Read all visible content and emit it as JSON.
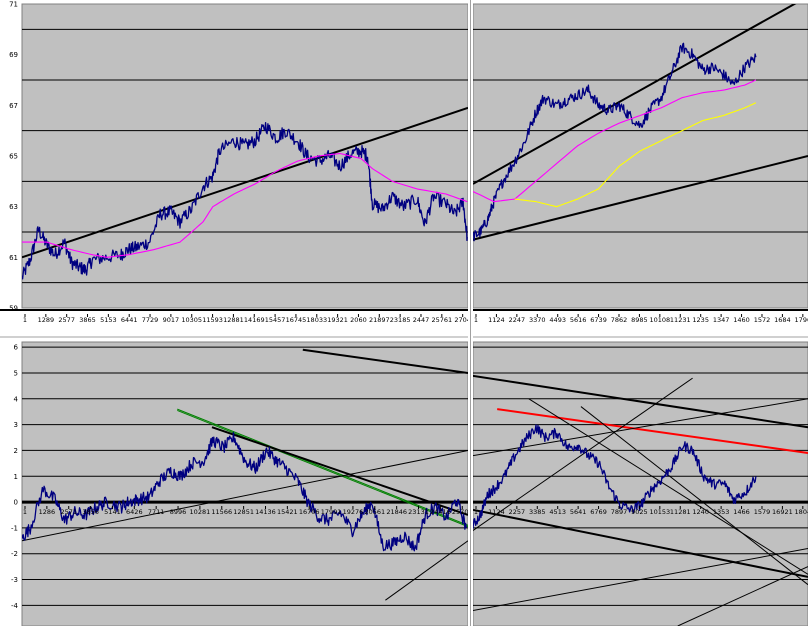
{
  "colors": {
    "plot_bg": "#c0c0c0",
    "frame": "#ffffff",
    "grid": "#000000",
    "price": "#000080",
    "ma_magenta": "#ff00ff",
    "ma_yellow": "#ffff00",
    "trend_black": "#000000",
    "trend_red": "#ff0000",
    "trend_green": "#008000"
  },
  "chart_data": [
    {
      "id": "top-left",
      "type": "line",
      "ylim": [
        59,
        71
      ],
      "y_ticks": [
        "71",
        "69",
        "67",
        "65",
        "63",
        "61",
        "59"
      ],
      "x_ticks": [
        "1",
        "1289",
        "2577",
        "3865",
        "5153",
        "6441",
        "7729",
        "9017",
        "10305",
        "11593",
        "12881",
        "14169",
        "15457",
        "16745",
        "18033",
        "19321",
        "2060",
        "21897",
        "23185",
        "2447",
        "25761",
        "2704"
      ],
      "xlim": [
        1,
        27100
      ],
      "series": [
        {
          "role": "price",
          "color": "#000080",
          "x": [
            1,
            500,
            1000,
            1500,
            2000,
            2577,
            3000,
            3500,
            3865,
            4300,
            5153,
            6000,
            6441,
            7000,
            7729,
            8400,
            9017,
            9600,
            10305,
            11000,
            11593,
            12000,
            12881,
            13500,
            14169,
            14800,
            15457,
            16000,
            16745,
            17300,
            18033,
            18700,
            19321,
            20000,
            20600,
            21000,
            21300,
            21897,
            22500,
            23185,
            24000,
            24470,
            25000,
            25761,
            26300,
            26800,
            27050
          ],
          "y": [
            60.2,
            60.9,
            62.1,
            61.5,
            61.1,
            61.6,
            60.8,
            60.6,
            60.5,
            60.9,
            61.0,
            61.1,
            61.3,
            61.4,
            61.6,
            62.7,
            62.8,
            62.4,
            62.9,
            63.8,
            64.2,
            65.2,
            65.6,
            65.4,
            65.6,
            66.2,
            65.7,
            66.0,
            65.6,
            65.0,
            64.8,
            65.0,
            64.6,
            65.1,
            65.2,
            65.0,
            63.1,
            62.9,
            63.4,
            63.0,
            63.3,
            62.3,
            63.4,
            63.1,
            62.7,
            63.2,
            61.8
          ],
          "noise": 0.26
        },
        {
          "role": "ma-magenta",
          "color": "#ff00ff",
          "x": [
            1,
            1500,
            3000,
            4300,
            5153,
            6441,
            8000,
            9600,
            10305,
            11000,
            11593,
            12881,
            14169,
            15457,
            16745,
            18033,
            19321,
            20600,
            21300,
            22500,
            24000,
            25761,
            27050
          ],
          "y": [
            61.6,
            61.6,
            61.3,
            61.1,
            61.0,
            61.1,
            61.3,
            61.6,
            62.0,
            62.4,
            63.0,
            63.5,
            63.9,
            64.4,
            64.8,
            65.0,
            65.1,
            64.9,
            64.5,
            64.0,
            63.7,
            63.5,
            63.2
          ],
          "noise": 0
        }
      ],
      "trendlines": [
        {
          "color": "#000000",
          "x1": 0,
          "y1": 61.0,
          "x2": 27100,
          "y2": 66.9,
          "width": 2
        }
      ]
    },
    {
      "id": "top-right",
      "type": "line",
      "ylim": [
        59,
        71
      ],
      "x_ticks": [
        "1",
        "1124",
        "2247",
        "3370",
        "4493",
        "5616",
        "6739",
        "7862",
        "8985",
        "10108",
        "11231",
        "1235",
        "1347",
        "1460",
        "1572",
        "1684",
        "1796"
      ],
      "xlim": [
        1,
        18000
      ],
      "series": [
        {
          "role": "price",
          "color": "#000080",
          "x": [
            1,
            400,
            800,
            1124,
            1600,
            2247,
            2800,
            3370,
            3800,
            4493,
            5000,
            5616,
            6200,
            6739,
            7300,
            7862,
            8400,
            8985,
            9500,
            10108,
            10700,
            11231,
            11800,
            12350,
            12900,
            13470,
            14000,
            14600,
            15200
          ],
          "y": [
            61.8,
            62.0,
            62.5,
            63.2,
            64.0,
            64.8,
            65.6,
            66.7,
            67.3,
            67.0,
            67.2,
            67.4,
            67.6,
            67.0,
            66.8,
            67.0,
            66.6,
            66.2,
            66.8,
            67.3,
            68.3,
            69.3,
            69.0,
            68.4,
            68.5,
            68.2,
            67.8,
            68.5,
            68.9
          ],
          "noise": 0.22
        },
        {
          "role": "ma-magenta",
          "color": "#ff00ff",
          "x": [
            1,
            1124,
            2247,
            3370,
            4493,
            5616,
            6739,
            7862,
            8985,
            10108,
            11231,
            12350,
            13470,
            14600,
            15200
          ],
          "y": [
            63.6,
            63.2,
            63.3,
            64.0,
            64.7,
            65.4,
            65.9,
            66.3,
            66.6,
            66.9,
            67.3,
            67.5,
            67.6,
            67.8,
            68.0
          ],
          "noise": 0
        },
        {
          "role": "ma-yellow",
          "color": "#ffff00",
          "x": [
            2247,
            3370,
            4493,
            5616,
            6739,
            7862,
            8985,
            10108,
            11231,
            12350,
            13470,
            14600,
            15200
          ],
          "y": [
            63.3,
            63.2,
            63.0,
            63.3,
            63.7,
            64.6,
            65.2,
            65.6,
            66.0,
            66.4,
            66.6,
            66.9,
            67.1
          ],
          "noise": 0
        }
      ],
      "trendlines": [
        {
          "color": "#000000",
          "x1": 1,
          "y1": 63.9,
          "x2": 18000,
          "y2": 71.3,
          "width": 2
        },
        {
          "color": "#000000",
          "x1": -3800,
          "y1": 61.0,
          "x2": 18000,
          "y2": 65.0,
          "width": 2
        }
      ]
    },
    {
      "id": "bottom-left",
      "type": "line",
      "ylim": [
        -4.8,
        6.2
      ],
      "y_ticks": [
        "6",
        "5",
        "4",
        "3",
        "2",
        "1",
        "0",
        "-1",
        "-2",
        "-3",
        "-4"
      ],
      "x_ticks": [
        "1",
        "1286",
        "2571",
        "3856",
        "5141",
        "6426",
        "7711",
        "8996",
        "10281",
        "11566",
        "12851",
        "14136",
        "15421",
        "16706",
        "17991",
        "19276",
        "20561",
        "21846",
        "23131",
        "24416",
        "25701"
      ],
      "xlim": [
        1,
        27000
      ],
      "series": [
        {
          "role": "price",
          "color": "#000080",
          "x": [
            1,
            500,
            1286,
            2000,
            2571,
            3200,
            3856,
            4500,
            5141,
            6000,
            6426,
            7000,
            7711,
            8300,
            8996,
            9600,
            10281,
            11000,
            11566,
            12200,
            12851,
            13500,
            14136,
            14800,
            15421,
            16000,
            16706,
            17300,
            17991,
            18600,
            19276,
            20000,
            20561,
            21200,
            21846,
            22500,
            23131,
            23800,
            24416,
            25000,
            25701,
            26300,
            26900
          ],
          "y": [
            -1.4,
            -1.0,
            0.5,
            0.1,
            -0.7,
            -0.4,
            -0.5,
            -0.2,
            0.0,
            -0.2,
            0.0,
            0.1,
            0.2,
            0.8,
            1.2,
            1.0,
            1.5,
            1.6,
            2.4,
            2.1,
            2.5,
            1.6,
            1.3,
            2.0,
            1.6,
            1.3,
            0.8,
            0.0,
            -0.6,
            -0.7,
            -0.4,
            -1.1,
            -0.5,
            0.0,
            -1.7,
            -1.6,
            -1.3,
            -1.8,
            -0.5,
            -0.2,
            -0.6,
            0.1,
            -1.0
          ],
          "noise": 0.24
        }
      ],
      "trendlines": [
        {
          "color": "#008000",
          "x1": 9400,
          "y1": 3.6,
          "x2": 27000,
          "y2": -0.9,
          "width": 1
        },
        {
          "color": "#008000",
          "x1": 9400,
          "y1": 3.55,
          "x2": 27000,
          "y2": -0.95,
          "width": 1
        },
        {
          "color": "#000000",
          "x1": 11500,
          "y1": 2.9,
          "x2": 27000,
          "y2": -0.5,
          "width": 2
        },
        {
          "color": "#000000",
          "x1": 1,
          "y1": -1.5,
          "x2": 27000,
          "y2": 2.0,
          "width": 1
        },
        {
          "color": "#000000",
          "x1": 17000,
          "y1": 5.9,
          "x2": 27000,
          "y2": 5.0,
          "width": 2
        },
        {
          "color": "#000000",
          "x1": 22000,
          "y1": -3.8,
          "x2": 27000,
          "y2": -1.5,
          "width": 1
        }
      ]
    },
    {
      "id": "bottom-right",
      "type": "line",
      "ylim": [
        -4.8,
        6.2
      ],
      "x_ticks": [
        "1",
        "1124",
        "2257",
        "3385",
        "4513",
        "5641",
        "6769",
        "7897",
        "9025",
        "10153",
        "11281",
        "1240",
        "1353",
        "1466",
        "1579",
        "16921",
        "1804"
      ],
      "xlim": [
        1,
        18000
      ],
      "series": [
        {
          "role": "price",
          "color": "#000080",
          "x": [
            1,
            400,
            800,
            1124,
            1700,
            2257,
            2800,
            3385,
            3900,
            4513,
            5100,
            5641,
            6200,
            6769,
            7300,
            7897,
            8500,
            9025,
            9600,
            10153,
            10700,
            11281,
            11800,
            12400,
            12900,
            13530,
            14000,
            14660,
            15200
          ],
          "y": [
            -0.9,
            -0.5,
            0.3,
            0.5,
            1.0,
            1.8,
            2.4,
            2.9,
            2.5,
            2.7,
            2.1,
            2.2,
            1.8,
            1.5,
            0.6,
            -0.1,
            -0.3,
            -0.1,
            0.5,
            0.9,
            1.4,
            2.2,
            2.0,
            1.0,
            0.7,
            0.7,
            0.1,
            0.4,
            1.0
          ],
          "noise": 0.2
        }
      ],
      "trendlines": [
        {
          "color": "#000000",
          "x1": -1000,
          "y1": 5.0,
          "x2": 18000,
          "y2": 2.9,
          "width": 2
        },
        {
          "color": "#ff0000",
          "x1": 1300,
          "y1": 3.6,
          "x2": 18000,
          "y2": 1.9,
          "width": 2
        },
        {
          "color": "#000000",
          "x1": 1,
          "y1": -0.3,
          "x2": 18000,
          "y2": -2.9,
          "width": 2
        },
        {
          "color": "#000000",
          "x1": 1,
          "y1": 1.8,
          "x2": 18000,
          "y2": 4.0,
          "width": 1
        },
        {
          "color": "#000000",
          "x1": -2200,
          "y1": -2.2,
          "x2": 11800,
          "y2": 4.8,
          "width": 1
        },
        {
          "color": "#000000",
          "x1": 3000,
          "y1": 4.0,
          "x2": 18000,
          "y2": -2.8,
          "width": 1
        },
        {
          "color": "#000000",
          "x1": 5800,
          "y1": 3.7,
          "x2": 18000,
          "y2": -3.2,
          "width": 1
        },
        {
          "color": "#000000",
          "x1": 1,
          "y1": -4.2,
          "x2": 18000,
          "y2": -1.8,
          "width": 1
        },
        {
          "color": "#000000",
          "x1": 11000,
          "y1": -4.8,
          "x2": 18000,
          "y2": -2.5,
          "width": 1
        }
      ]
    }
  ]
}
